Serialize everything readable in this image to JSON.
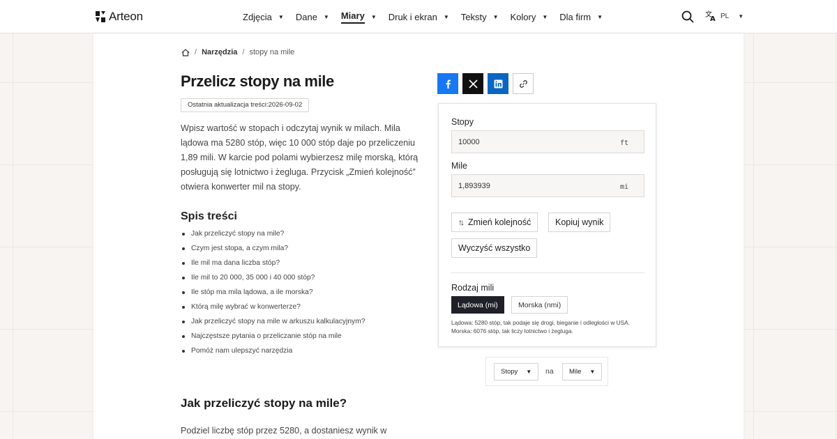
{
  "brand": {
    "name": "Arteon"
  },
  "nav": {
    "items": [
      {
        "label": "Zdjęcia"
      },
      {
        "label": "Dane"
      },
      {
        "label": "Miary"
      },
      {
        "label": "Druk i ekran"
      },
      {
        "label": "Teksty"
      },
      {
        "label": "Kolory"
      },
      {
        "label": "Dla firm"
      }
    ],
    "active": "Miary"
  },
  "header": {
    "lang": "PL"
  },
  "breadcrumb": {
    "section": "Narzędzia",
    "current": "stopy na mile"
  },
  "page": {
    "title": "Przelicz stopy na mile",
    "updated": "Ostatnia aktualizacja treści:2026-09-02",
    "intro": "Wpisz wartość w stopach i odczytaj wynik w milach. Mila lądowa ma 5280 stóp, więc 10 000 stóp daje po przeliczeniu 1,89 mili. W karcie pod polami wybierzesz milę morską, którą posługują się lotnictwo i żegluga. Przycisk „Zmień kolejność” otwiera konwerter mil na stopy."
  },
  "toc": {
    "title": "Spis treści",
    "items": [
      "Jak przeliczyć stopy na mile?",
      "Czym jest stopa, a czym mila?",
      "Ile mil ma dana liczba stóp?",
      "Ile mil to 20 000, 35 000 i 40 000 stóp?",
      "Ile stóp ma mila lądowa, a ile morska?",
      "Którą milę wybrać w konwerterze?",
      "Jak przeliczyć stopy na mile w arkuszu kalkulacyjnym?",
      "Najczęstsze pytania o przeliczanie stóp na mile",
      "Pomóż nam ulepszyć narzędzia"
    ]
  },
  "section": {
    "title": "Jak przeliczyć stopy na mile?",
    "text": "Podziel liczbę stóp przez 5280, a dostaniesz wynik w"
  },
  "converter": {
    "from": {
      "label": "Stopy",
      "value": "10000",
      "unit": "ft"
    },
    "to": {
      "label": "Mile",
      "value": "1,893939",
      "unit": "mi"
    },
    "buttons": {
      "swap": "Zmień kolejność",
      "copy": "Kopiuj wynik",
      "clear": "Wyczyść wszystko"
    },
    "mile_type": {
      "label": "Rodzaj mili",
      "options": [
        "Lądowa (mi)",
        "Morska (nmi)"
      ],
      "selected": "Lądowa (mi)",
      "note": "Lądowa: 5280 stóp, tak podaje się drogi, bieganie i odległości w USA. Morska: 6076 stóp, tak liczy lotnictwo i żegluga."
    }
  },
  "unit_switcher": {
    "from": "Stopy",
    "connector": "na",
    "to": "Mile"
  },
  "colors": {
    "facebook": "#1877f2",
    "x": "#111111",
    "linkedin": "#0a66c2",
    "toggle_active": "#1f2028"
  },
  "icons": [
    "home-icon",
    "search-icon",
    "translate-icon",
    "facebook-icon",
    "x-icon",
    "linkedin-icon",
    "link-icon",
    "swap-icon",
    "chevron-down-icon"
  ]
}
